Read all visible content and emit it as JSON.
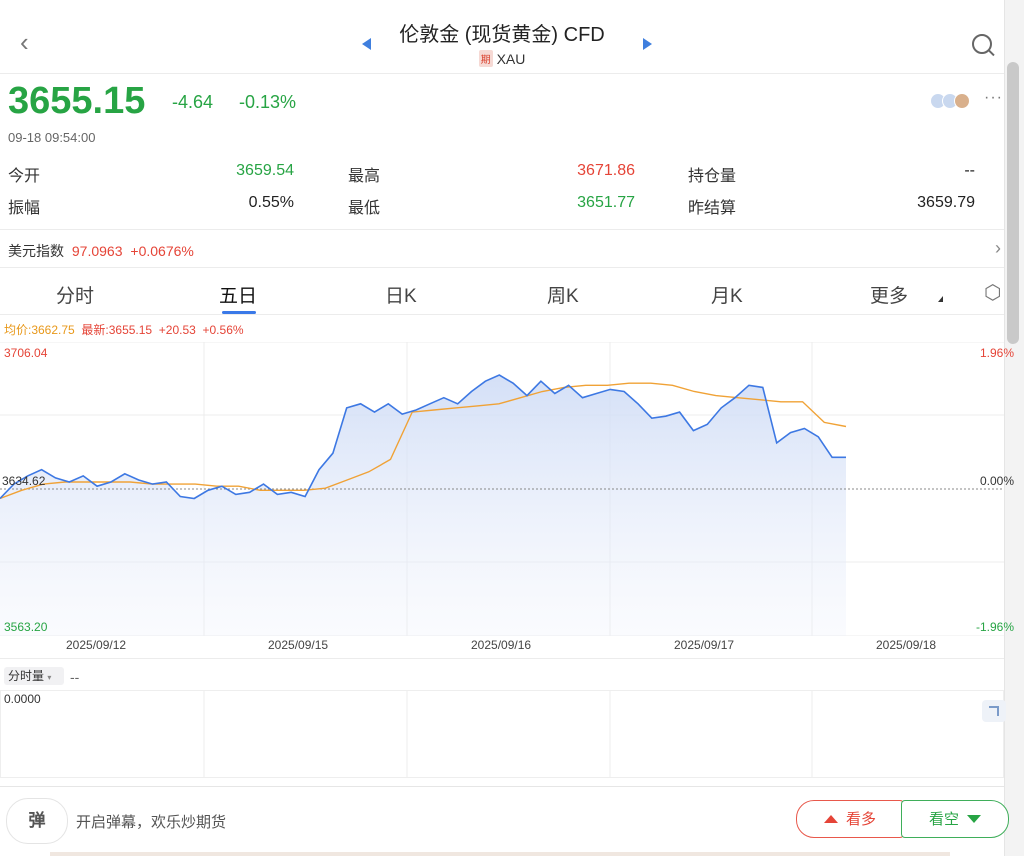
{
  "header": {
    "title": "伦敦金 (现货黄金) CFD",
    "badge": "期",
    "symbol": "XAU"
  },
  "quote": {
    "price": "3655.15",
    "change": "-4.64",
    "change_pct": "-0.13%",
    "time": "09-18 09:54:00"
  },
  "stats": {
    "open_label": "今开",
    "open": "3659.54",
    "high_label": "最高",
    "high": "3671.86",
    "oi_label": "持仓量",
    "oi": "--",
    "amp_label": "振幅",
    "amp": "0.55%",
    "low_label": "最低",
    "low": "3651.77",
    "prev_label": "昨结算",
    "prev": "3659.79"
  },
  "usd_index": {
    "label": "美元指数",
    "value": "97.0963",
    "change": "+0.0676%"
  },
  "tabs": [
    "分时",
    "五日",
    "日K",
    "周K",
    "月K",
    "更多"
  ],
  "legend": {
    "avg": "均价:3662.75",
    "latest": "最新:3655.15",
    "chg": "+20.53",
    "pct": "+0.56%"
  },
  "axis": {
    "top": "3706.04",
    "mid": "3634.62",
    "bottom": "3563.20",
    "top_pct": "1.96%",
    "mid_pct": "0.00%",
    "bottom_pct": "-1.96%"
  },
  "chart_data": {
    "type": "line",
    "ylim": [
      3563.2,
      3706.04
    ],
    "x_labels": [
      "2025/09/12",
      "2025/09/15",
      "2025/09/16",
      "2025/09/17",
      "2025/09/18"
    ],
    "reference": 3634.62,
    "series": [
      {
        "values": [
          3630,
          3637,
          3641,
          3644,
          3640,
          3638,
          3641,
          3636,
          3638,
          3642,
          3639,
          3637,
          3638,
          3631,
          3630,
          3634,
          3636,
          3632,
          3633,
          3637,
          3632,
          3633,
          3631,
          3644,
          3652,
          3674,
          3676,
          3672,
          3676,
          3671,
          3673,
          3676,
          3679,
          3676,
          3682,
          3687,
          3690,
          3686,
          3680,
          3687,
          3681,
          3685,
          3679,
          3681,
          3683,
          3682,
          3676,
          3669,
          3670,
          3672,
          3663,
          3666,
          3674,
          3679,
          3685,
          3684,
          3657,
          3662,
          3664,
          3660,
          3650,
          3650
        ],
        "color": "#3d78e3"
      },
      {
        "values": [
          3630,
          3634,
          3637,
          3638,
          3638,
          3638,
          3638,
          3637,
          3637,
          3637,
          3636,
          3636,
          3634,
          3634,
          3634,
          3635,
          3639,
          3643,
          3649,
          3672,
          3673,
          3674,
          3675,
          3676,
          3679,
          3682,
          3684,
          3685,
          3685,
          3686,
          3686,
          3685,
          3682,
          3680,
          3679,
          3678,
          3677,
          3677,
          3667,
          3665
        ],
        "color": "#f0a236"
      }
    ]
  },
  "volume": {
    "label": "分时量",
    "dash": "--",
    "value": "0.0000"
  },
  "bottom": {
    "danmu_icon": "弹",
    "danmu_text": "开启弹幕，欢乐炒期货",
    "buy": "看多",
    "sell": "看空"
  }
}
